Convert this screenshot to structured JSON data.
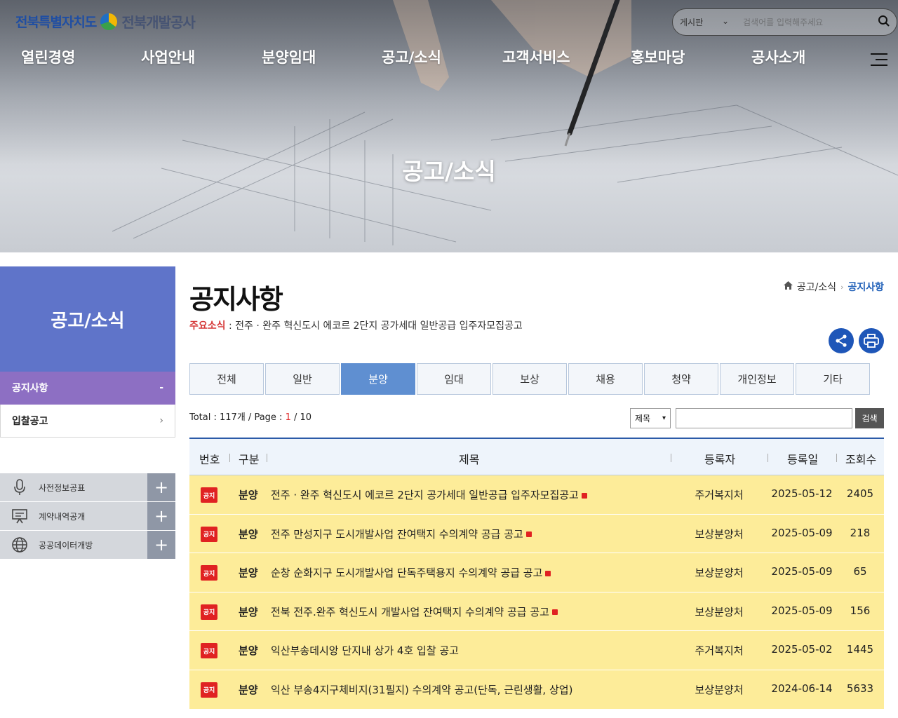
{
  "header": {
    "logo_primary": "전북특별자치도",
    "logo_secondary": "전북개발공사",
    "search": {
      "category": "게시판",
      "placeholder": "검색어를 입력해주세요"
    },
    "gnb": [
      "열린경영",
      "사업안내",
      "분양임대",
      "공고/소식",
      "고객서비스",
      "홍보마당",
      "공사소개"
    ],
    "hero_title": "공고/소식"
  },
  "sidebar": {
    "title": "공고/소식",
    "items": [
      {
        "label": "공지사항",
        "mark": "-"
      },
      {
        "label": "입찰공고",
        "mark": "›"
      }
    ],
    "quick_links": [
      {
        "label": "사전정보공표",
        "icon": "microphone-icon"
      },
      {
        "label": "계약내역공개",
        "icon": "presentation-board-icon"
      },
      {
        "label": "공공데이터개방",
        "icon": "globe-icon"
      }
    ],
    "plus": "+"
  },
  "main": {
    "title": "공지사항",
    "breadcrumb": {
      "parent": "공고/소식",
      "current": "공지사항"
    },
    "ticker": {
      "label": "주요소식",
      "text": " : 전주 · 완주 혁신도시 에코르 2단지 공가세대 일반공급 입주자모집공고"
    },
    "tabs": [
      "전체",
      "일반",
      "분양",
      "임대",
      "보상",
      "채용",
      "청약",
      "개인정보",
      "기타"
    ],
    "active_tab": "분양",
    "total": {
      "label": "Total : ",
      "count": "117개",
      "page_label": " / Page : ",
      "page": "1",
      "pages": " / 10"
    },
    "search": {
      "field": "제목",
      "button": "검색"
    },
    "columns": [
      "번호",
      "구분",
      "제목",
      "등록자",
      "등록일",
      "조회수"
    ],
    "badge": "공지",
    "rows": [
      {
        "category": "분양",
        "title": "전주 · 완주 혁신도시 에코르 2단지 공가세대 일반공급 입주자모집공고",
        "new": true,
        "writer": "주거복지처",
        "date": "2025-05-12",
        "hits": "2405"
      },
      {
        "category": "분양",
        "title": "전주 만성지구 도시개발사업 잔여택지 수의계약 공급 공고",
        "new": true,
        "writer": "보상분양처",
        "date": "2025-05-09",
        "hits": "218"
      },
      {
        "category": "분양",
        "title": "순창 순화지구 도시개발사업 단독주택용지 수의계약 공급 공고",
        "new": true,
        "writer": "보상분양처",
        "date": "2025-05-09",
        "hits": "65"
      },
      {
        "category": "분양",
        "title": "전북 전주.완주 혁신도시 개발사업 잔여택지 수의계약 공급 공고",
        "new": true,
        "writer": "보상분양처",
        "date": "2025-05-09",
        "hits": "156"
      },
      {
        "category": "분양",
        "title": "익산부송데시앙 단지내 상가 4호 입찰 공고",
        "new": false,
        "writer": "주거복지처",
        "date": "2025-05-02",
        "hits": "1445"
      },
      {
        "category": "분양",
        "title": "익산 부송4지구체비지(31필지) 수의계약 공고(단독, 근린생활, 상업)",
        "new": false,
        "writer": "보상분양처",
        "date": "2024-06-14",
        "hits": "5633"
      }
    ]
  },
  "colors": {
    "lnb_head": "#5f74c9",
    "lnb_active": "#8d6fc3",
    "tab_active": "#5f8fd1",
    "row_highlight": "#fdec99",
    "badge": "#e02222",
    "circle_button": "#1e56b8"
  }
}
